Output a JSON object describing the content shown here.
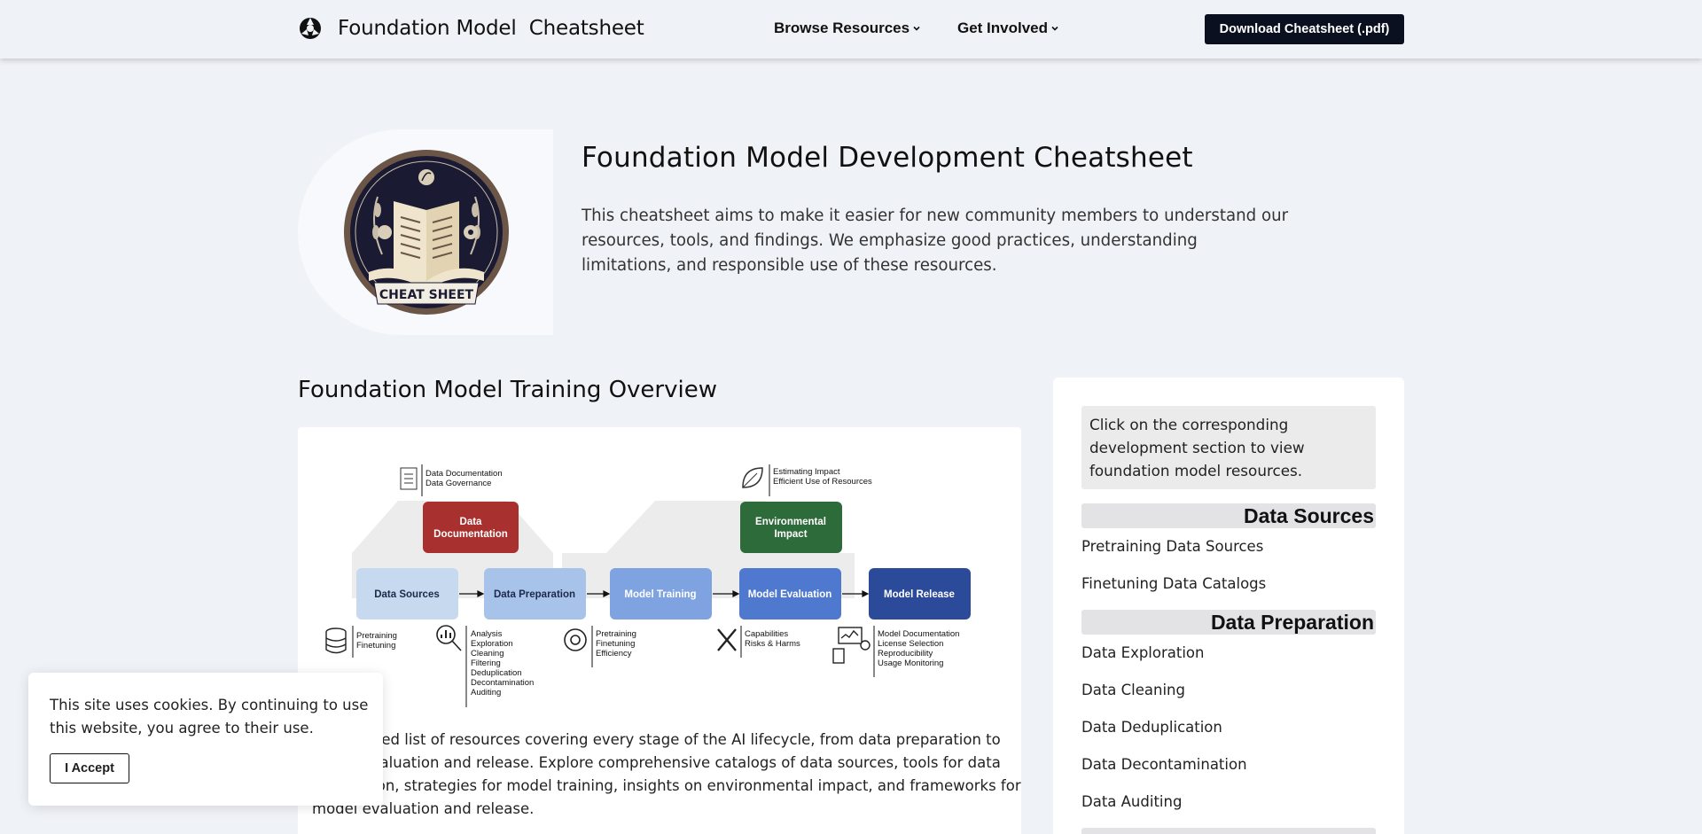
{
  "nav": {
    "brand_title": "Foundation Model  Cheatsheet",
    "browse_label": "Browse Resources",
    "involved_label": "Get Involved",
    "download_label": "Download Cheatsheet (.pdf)"
  },
  "hero": {
    "title": "Foundation Model Development Cheatsheet",
    "description": "This cheatsheet aims to make it easier for new community members to understand our resources, tools, and findings. We emphasize good practices, understanding limitations, and responsible use of these resources.",
    "seal_text": "CHEAT SHEET"
  },
  "overview": {
    "title": "Foundation Model Training Overview",
    "text": "Our curated list of resources covering every stage of the AI lifecycle, from data preparation to model evaluation and release. Explore comprehensive catalogs of data sources, tools for data exploration, strategies for model training, insights on environmental impact, and frameworks for model evaluation and release.",
    "diagram": {
      "top_labels": {
        "documentation": [
          "Data Documentation",
          "Data Governance"
        ],
        "environment": [
          "Estimating Impact",
          "Efficient Use of Resources"
        ]
      },
      "stages": {
        "data_documentation": [
          "Data",
          "Documentation"
        ],
        "environmental_impact": [
          "Environmental",
          "Impact"
        ],
        "data_sources": "Data Sources",
        "data_preparation": "Data Preparation",
        "model_training": "Model Training",
        "model_evaluation": "Model Evaluation",
        "model_release": "Model Release"
      },
      "bottom_labels": {
        "sources": [
          "Pretraining",
          "Finetuning"
        ],
        "preparation": [
          "Analysis",
          "Exploration",
          "Cleaning",
          "Filtering",
          "Deduplication",
          "Decontamination",
          "Auditing"
        ],
        "training": [
          "Pretraining",
          "Finetuning",
          "Efficiency"
        ],
        "evaluation": [
          "Capabilities",
          "Risks & Harms"
        ],
        "release": [
          "Model Documentation",
          "License Selection",
          "Reproducibility",
          "Usage Monitoring"
        ]
      },
      "colors": {
        "documentation": "#a8302f",
        "environment": "#2e6b3a",
        "sources": "#c6d9ef",
        "preparation": "#a7c3ea",
        "training": "#7fa3e0",
        "evaluation": "#4f78cf",
        "release": "#2b4a9a"
      }
    }
  },
  "sidebar": {
    "note": "Click on the corresponding development section to view foundation model resources.",
    "sections": [
      {
        "heading": "Data Sources",
        "links": [
          "Pretraining Data Sources",
          "Finetuning Data Catalogs"
        ]
      },
      {
        "heading": "Data Preparation",
        "links": [
          "Data Exploration",
          "Data Cleaning",
          "Data Deduplication",
          "Data Decontamination",
          "Data Auditing"
        ]
      }
    ]
  },
  "cookie": {
    "text": "This site uses cookies. By continuing to use this website, you agree to their use.",
    "accept_label": "I Accept"
  }
}
